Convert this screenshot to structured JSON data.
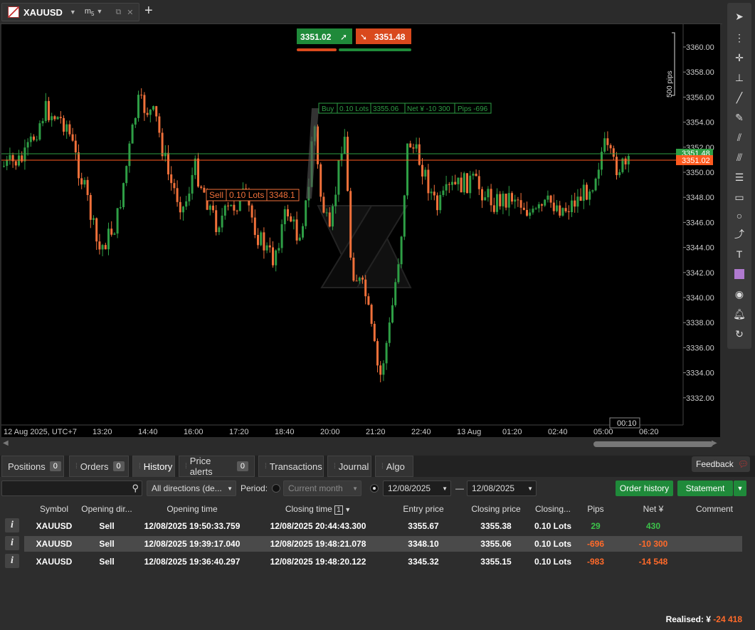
{
  "window": {
    "symbol_tab": "XAUUSD",
    "timeframe": "m",
    "timeframe_sub": "5"
  },
  "chart": {
    "bid": "3351.02",
    "ask": "3351.48",
    "pips_label": "500 pips",
    "price_labels": [
      "3360.00",
      "3358.00",
      "3356.00",
      "3354.00",
      "3352.00",
      "3350.00",
      "3348.00",
      "3346.00",
      "3344.00",
      "3342.00",
      "3340.00",
      "3338.00",
      "3336.00",
      "3334.00",
      "3332.00"
    ],
    "time_labels": [
      "12 Aug 2025, UTC+7",
      "13:20",
      "14:40",
      "16:00",
      "17:20",
      "18:40",
      "20:00",
      "21:20",
      "22:40",
      "13 Aug",
      "01:20",
      "02:40",
      "05:00",
      "06:20"
    ],
    "bid_tag": "3351.02",
    "ask_tag": "3351.48",
    "countdown": "00:10",
    "buy_label": {
      "side": "Buy",
      "lots": "0.10 Lots",
      "price": "3355.06",
      "net": "Net ¥ -10 300",
      "pips": "Pips -696"
    },
    "sell_label": {
      "side": "Sell",
      "lots": "0.10 Lots",
      "price": "3348.1"
    },
    "colors": {
      "up": "#2e9e45",
      "down": "#f0703a",
      "bid_line": "#ff5a1f",
      "ask_line": "#2e9e45"
    }
  },
  "bottom_tabs": [
    {
      "label": "Positions",
      "badge": "0"
    },
    {
      "label": "Orders",
      "badge": "0"
    },
    {
      "label": "History",
      "badge": ""
    },
    {
      "label": "Price alerts",
      "badge": "0"
    },
    {
      "label": "Transactions",
      "badge": ""
    },
    {
      "label": "Journal",
      "badge": ""
    },
    {
      "label": "Algo",
      "badge": ""
    }
  ],
  "feedback": "Feedback",
  "filters": {
    "search_value": "",
    "direction": "All directions (de...",
    "period_label": "Period:",
    "period_value": "Current month",
    "date_from": "12/08/2025",
    "date_dash": "—",
    "date_to": "12/08/2025",
    "order_history": "Order history",
    "statement": "Statement"
  },
  "table": {
    "headers": [
      "Symbol",
      "Opening dir...",
      "Opening time",
      "Closing time",
      "Entry price",
      "Closing price",
      "Closing...",
      "Pips",
      "Net ¥",
      "Comment"
    ],
    "sort_badge": "1",
    "rows": [
      [
        "XAUUSD",
        "Sell",
        "12/08/2025 19:50:33.759",
        "12/08/2025 20:44:43.300",
        "3355.67",
        "3355.38",
        "0.10 Lots",
        "29",
        "430",
        ""
      ],
      [
        "XAUUSD",
        "Sell",
        "12/08/2025 19:39:17.040",
        "12/08/2025 19:48:21.078",
        "3348.10",
        "3355.06",
        "0.10 Lots",
        "-696",
        "-10 300",
        ""
      ],
      [
        "XAUUSD",
        "Sell",
        "12/08/2025 19:36:40.297",
        "12/08/2025 19:48:20.122",
        "3345.32",
        "3355.15",
        "0.10 Lots",
        "-983",
        "-14 548",
        ""
      ]
    ]
  },
  "realised_label": "Realised:",
  "realised_currency": "¥",
  "realised_value": "-24 418"
}
